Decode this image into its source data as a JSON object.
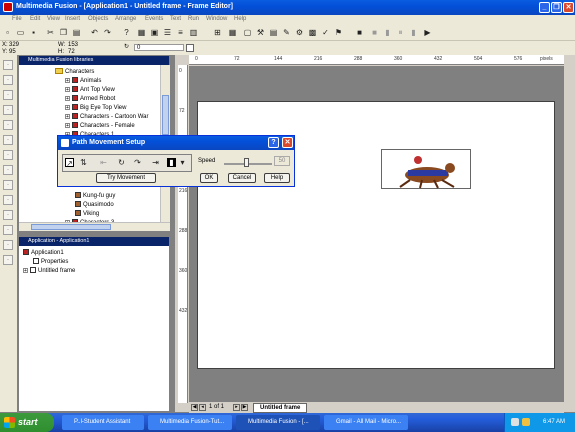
{
  "window": {
    "title": "Multimedia Fusion - [Application1 - Untitled frame - Frame Editor]",
    "controls": {
      "minimize": "_",
      "restore": "❐",
      "close": "✕"
    }
  },
  "menu": [
    "File",
    "Edit",
    "View",
    "Insert",
    "Objects",
    "Arrange",
    "Events",
    "Text",
    "Run",
    "Window",
    "Help"
  ],
  "toolbar2": {
    "x_label": "X:",
    "x_value": "329",
    "y_label": "Y:",
    "y_value": "95",
    "w_label": "W:",
    "w_value": "153",
    "h_label": "H:",
    "h_value": "72",
    "angle_value": "0"
  },
  "libraries": {
    "title": "Multimedia Fusion libraries",
    "items": [
      {
        "label": "Characters",
        "kind": "folder"
      },
      {
        "label": "Animals",
        "kind": "item"
      },
      {
        "label": "Ant Top View",
        "kind": "item"
      },
      {
        "label": "Armed Robot",
        "kind": "item"
      },
      {
        "label": "Big Eye Top View",
        "kind": "item"
      },
      {
        "label": "Characters - Cartoon War",
        "kind": "item"
      },
      {
        "label": "Characters - Female",
        "kind": "item"
      },
      {
        "label": "Characters 1",
        "kind": "item"
      }
    ],
    "items_lower": [
      {
        "label": "Kung-fu guy"
      },
      {
        "label": "Quasimodo"
      },
      {
        "label": "Viking"
      },
      {
        "label": "Characters 3"
      }
    ]
  },
  "application_panel": {
    "title": "Application - Application1",
    "items": [
      {
        "label": "Application1"
      },
      {
        "label": "Properties"
      },
      {
        "label": "Untitled frame"
      }
    ]
  },
  "rulers": {
    "horizontal": [
      "0",
      "72",
      "144",
      "216",
      "288",
      "360",
      "432",
      "504",
      "576"
    ],
    "vertical": [
      "0",
      "72",
      "144",
      "216",
      "288",
      "360",
      "432"
    ],
    "unit": "pixels"
  },
  "editor_tabs": {
    "page": "1 of 1",
    "tab": "Untitled frame"
  },
  "dialog": {
    "title": "Path Movement Setup",
    "speed_label": "Speed",
    "speed_value": "50",
    "try_movement": "Try Movement",
    "ok": "OK",
    "cancel": "Cancel",
    "help": "Help",
    "help_icon": "?",
    "close_icon": "✕"
  },
  "taskbar": {
    "start": "start",
    "tasks": [
      {
        "label": "P..l-Student Assistant"
      },
      {
        "label": "Multimedia Fusion-Tut..."
      },
      {
        "label": "Multimedia Fusion - [..."
      },
      {
        "label": "Gmail - All Mail - Micro..."
      }
    ],
    "clock": "6:47 AM"
  }
}
